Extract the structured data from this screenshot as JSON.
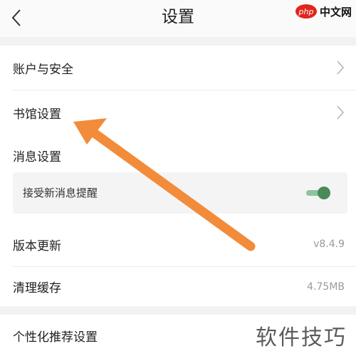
{
  "header": {
    "title": "设置",
    "back_icon": "chevron-left-icon"
  },
  "watermark_top": {
    "badge": "php",
    "text": "中文网"
  },
  "settings": {
    "account_security": "账户与安全",
    "library_settings": "书馆设置",
    "message_settings": "消息设置",
    "receive_new_messages": "接受新消息提醒",
    "receive_new_messages_enabled": true,
    "version_update": "版本更新",
    "version_value": "v8.4.9",
    "clear_cache": "清理缓存",
    "cache_size": "4.75MB",
    "personalized_recommendation": "个性化推荐设置"
  },
  "annotation": {
    "arrow_color": "#f28c3a"
  },
  "watermark_bottom": {
    "text": "软件技巧"
  },
  "colors": {
    "toggle_on": "#4a8a5a",
    "background": "#f2f2f2",
    "card": "#ffffff"
  }
}
